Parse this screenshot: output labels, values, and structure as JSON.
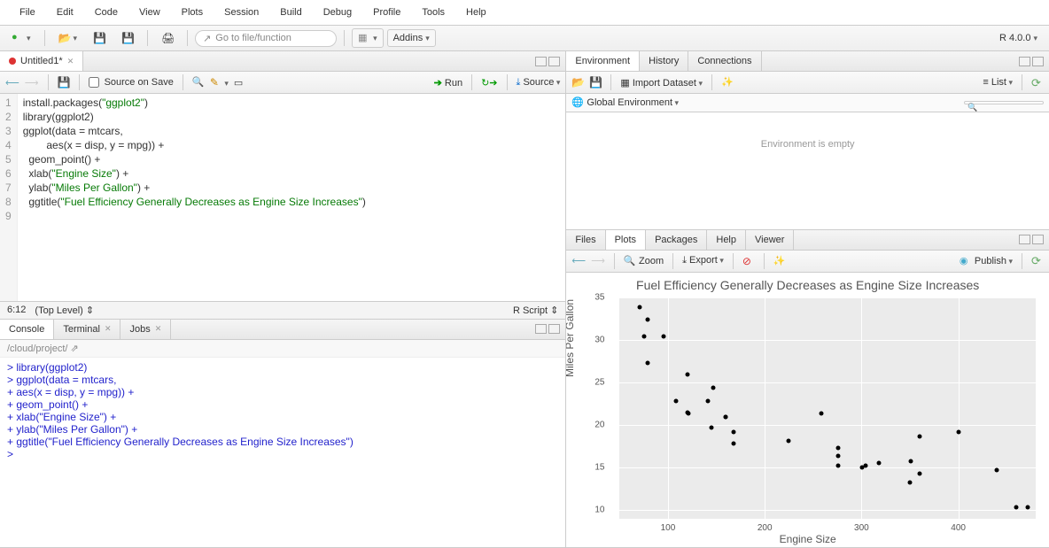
{
  "menubar": [
    "File",
    "Edit",
    "Code",
    "View",
    "Plots",
    "Session",
    "Build",
    "Debug",
    "Profile",
    "Tools",
    "Help"
  ],
  "goto_placeholder": "Go to file/function",
  "addins_label": "Addins",
  "r_version": "R 4.0.0",
  "source_tab": {
    "title": "Untitled1*"
  },
  "source_toolbar": {
    "source_on_save": "Source on Save",
    "run": "Run",
    "source": "Source"
  },
  "code_lines": [
    "install.packages(\"ggplot2\")",
    "library(ggplot2)",
    "ggplot(data = mtcars,",
    "        aes(x = disp, y = mpg)) +",
    "  geom_point() +",
    "  xlab(\"Engine Size\") +",
    "  ylab(\"Miles Per Gallon\") +",
    "  ggtitle(\"Fuel Efficiency Generally Decreases as Engine Size Increases\")",
    ""
  ],
  "code_highlighted": [
    "install.packages(<span class='str'>\"ggplot2\"</span>)",
    "library(ggplot2)",
    "ggplot(data = mtcars,",
    "        aes(x = disp, y = mpg)) +",
    "  geom_point() +",
    "  xlab(<span class='str'>\"Engine Size\"</span>) +",
    "  ylab(<span class='str'>\"Miles Per Gallon\"</span>) +",
    "  ggtitle(<span class='str'>\"Fuel Efficiency Generally Decreases as Engine Size Increases\"</span>)",
    ""
  ],
  "status": {
    "cursor": "6:12",
    "scope": "(Top Level)",
    "type": "R Script"
  },
  "console_tabs": [
    "Console",
    "Terminal",
    "Jobs"
  ],
  "console_path": "/cloud/project/",
  "console_lines": [
    {
      "p": "> ",
      "t": "library(ggplot2)"
    },
    {
      "p": "> ",
      "t": "ggplot(data = mtcars,"
    },
    {
      "p": "+ ",
      "t": "       aes(x = disp, y = mpg)) +"
    },
    {
      "p": "+ ",
      "t": "  geom_point() +"
    },
    {
      "p": "+ ",
      "t": "  xlab(\"Engine Size\") +"
    },
    {
      "p": "+ ",
      "t": "  ylab(\"Miles Per Gallon\") +"
    },
    {
      "p": "+ ",
      "t": "  ggtitle(\"Fuel Efficiency Generally Decreases as Engine Size Increases\")"
    },
    {
      "p": "> ",
      "t": ""
    }
  ],
  "env_tabs": [
    "Environment",
    "History",
    "Connections"
  ],
  "env_toolbar": {
    "import": "Import Dataset",
    "list": "List"
  },
  "env_scope": "Global Environment",
  "env_empty": "Environment is empty",
  "files_tabs": [
    "Files",
    "Plots",
    "Packages",
    "Help",
    "Viewer"
  ],
  "plot_toolbar": {
    "zoom": "Zoom",
    "export": "Export",
    "publish": "Publish"
  },
  "chart_data": {
    "type": "scatter",
    "title": "Fuel Efficiency Generally Decreases as Engine Size Increases",
    "xlabel": "Engine Size",
    "ylabel": "Miles Per Gallon",
    "xlim": [
      50,
      480
    ],
    "ylim": [
      9,
      35
    ],
    "xticks": [
      100,
      200,
      300,
      400
    ],
    "yticks": [
      10,
      15,
      20,
      25,
      30,
      35
    ],
    "points": [
      {
        "x": 160,
        "y": 21
      },
      {
        "x": 160,
        "y": 21
      },
      {
        "x": 108,
        "y": 22.8
      },
      {
        "x": 258,
        "y": 21.4
      },
      {
        "x": 360,
        "y": 18.7
      },
      {
        "x": 225,
        "y": 18.1
      },
      {
        "x": 360,
        "y": 14.3
      },
      {
        "x": 146.7,
        "y": 24.4
      },
      {
        "x": 140.8,
        "y": 22.8
      },
      {
        "x": 167.6,
        "y": 19.2
      },
      {
        "x": 167.6,
        "y": 17.8
      },
      {
        "x": 275.8,
        "y": 16.4
      },
      {
        "x": 275.8,
        "y": 17.3
      },
      {
        "x": 275.8,
        "y": 15.2
      },
      {
        "x": 472,
        "y": 10.4
      },
      {
        "x": 460,
        "y": 10.4
      },
      {
        "x": 440,
        "y": 14.7
      },
      {
        "x": 78.7,
        "y": 32.4
      },
      {
        "x": 75.7,
        "y": 30.4
      },
      {
        "x": 71.1,
        "y": 33.9
      },
      {
        "x": 120.1,
        "y": 21.5
      },
      {
        "x": 318,
        "y": 15.5
      },
      {
        "x": 304,
        "y": 15.2
      },
      {
        "x": 350,
        "y": 13.3
      },
      {
        "x": 400,
        "y": 19.2
      },
      {
        "x": 79,
        "y": 27.3
      },
      {
        "x": 120.3,
        "y": 26
      },
      {
        "x": 95.1,
        "y": 30.4
      },
      {
        "x": 351,
        "y": 15.8
      },
      {
        "x": 145,
        "y": 19.7
      },
      {
        "x": 301,
        "y": 15
      },
      {
        "x": 121,
        "y": 21.4
      }
    ]
  }
}
